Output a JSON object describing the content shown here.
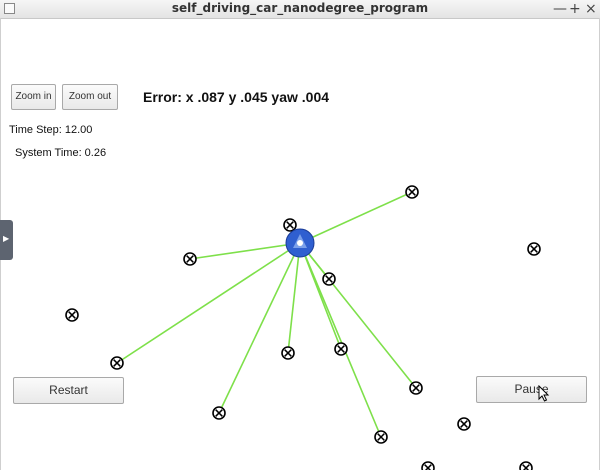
{
  "window": {
    "title": "self_driving_car_nanodegree_program",
    "controls": {
      "minimize": "—",
      "maximize": "+",
      "close": "×"
    }
  },
  "toolbar": {
    "zoom_in_label": "Zoom in",
    "zoom_out_label": "Zoom out"
  },
  "error_readout": "Error: x .087 y .045 yaw .004",
  "status": {
    "time_step": "Time Step: 12.00",
    "system_time": "System Time: 0.26"
  },
  "buttons": {
    "restart_label": "Restart",
    "pause_label": "Pause"
  },
  "colors": {
    "car": "#2f5fd0",
    "observation_line": "#7ee04a",
    "landmark": "#000000"
  },
  "icons": {
    "side_panel_toggle": "chevron-right-icon",
    "landmark_marker": "circled-x-icon",
    "vehicle": "car-icon"
  }
}
